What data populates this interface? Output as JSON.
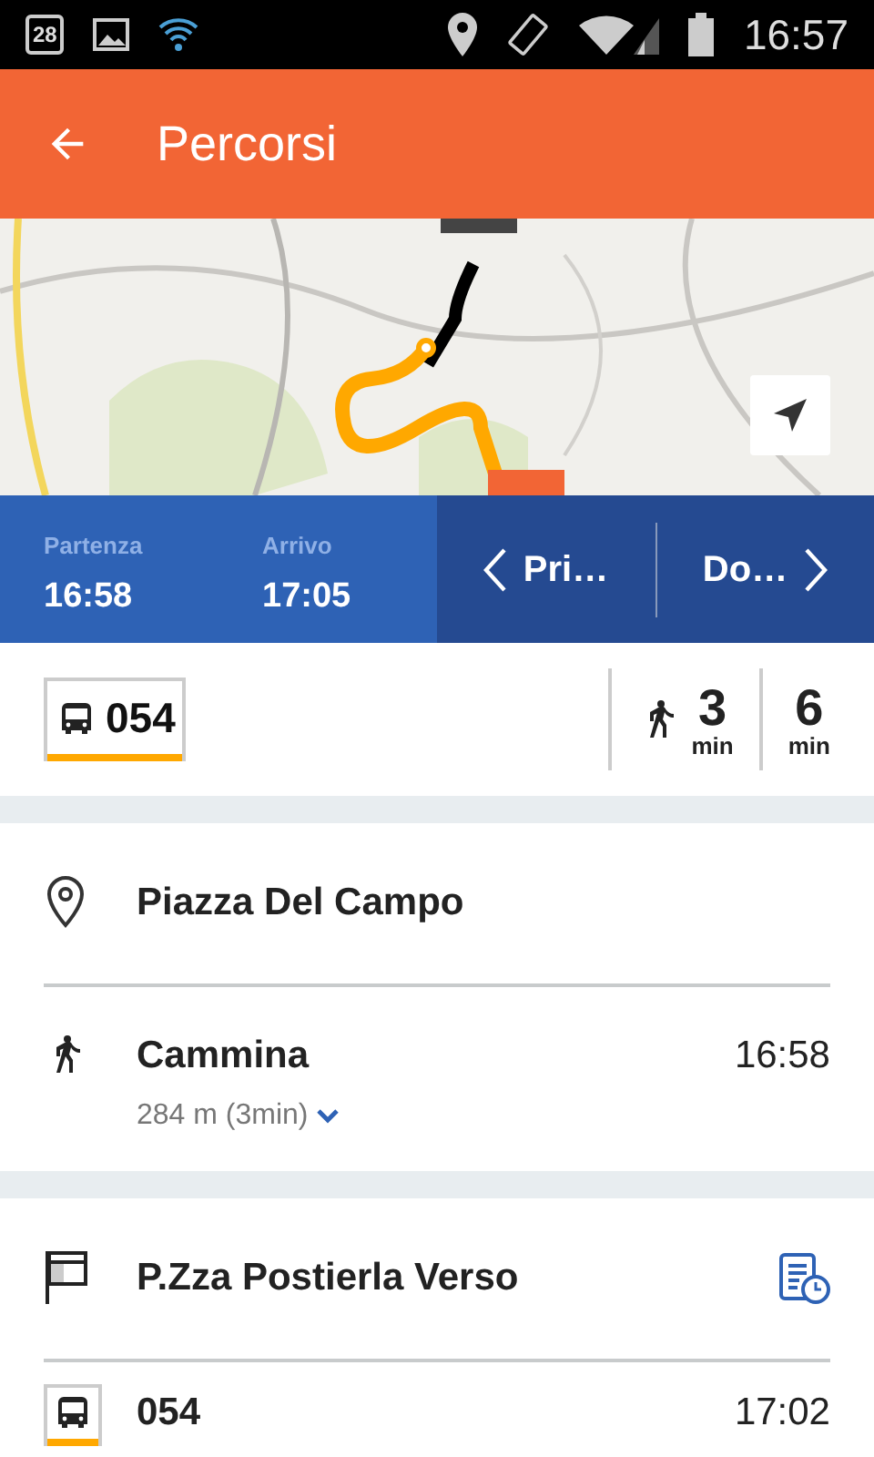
{
  "status_bar": {
    "calendar_day": "28",
    "time": "16:57"
  },
  "app_bar": {
    "title": "Percorsi"
  },
  "times": {
    "departure_label": "Partenza",
    "departure": "16:58",
    "arrival_label": "Arrivo",
    "arrival": "17:05",
    "prev": "Pri…",
    "next": "Do…"
  },
  "summary": {
    "line": "054",
    "color": "#ffa800",
    "walk": "3",
    "walk_unit": "min",
    "total": "6",
    "total_unit": "min"
  },
  "sections": [
    {
      "steps": [
        {
          "kind": "place",
          "title": "Piazza Del Campo"
        },
        {
          "kind": "walk",
          "title": "Cammina",
          "time": "16:58",
          "detail": "284 m (3min)",
          "expanded": false
        }
      ]
    },
    {
      "steps": [
        {
          "kind": "stop",
          "title": "P.Zza Postierla Verso"
        },
        {
          "kind": "bus",
          "title": "054",
          "time": "17:02",
          "color": "#ffa800"
        }
      ]
    }
  ]
}
